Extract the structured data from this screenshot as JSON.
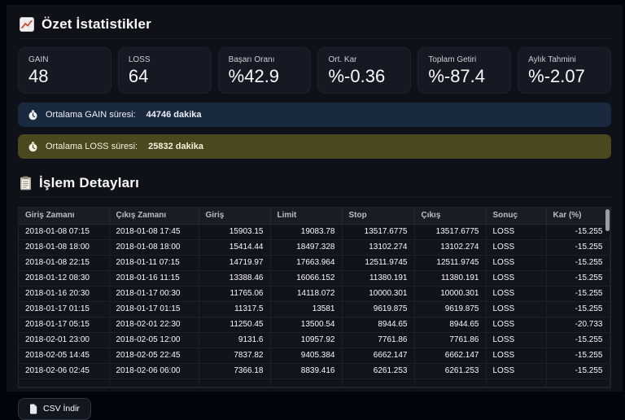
{
  "summary": {
    "title": "Özet İstatistikler",
    "cards": [
      {
        "label": "GAIN",
        "value": "48"
      },
      {
        "label": "LOSS",
        "value": "64"
      },
      {
        "label": "Başarı Oranı",
        "value": "%42.9"
      },
      {
        "label": "Ort. Kar",
        "value": "%-0.36"
      },
      {
        "label": "Toplam Getiri",
        "value": "%-87.4"
      },
      {
        "label": "Aylık Tahmini",
        "value": "%-2.07"
      }
    ],
    "gain_info": {
      "label": "Ortalama GAIN süresi:",
      "value": "44746 dakika"
    },
    "loss_info": {
      "label": "Ortalama LOSS süresi:",
      "value": "25832 dakika"
    }
  },
  "details": {
    "title": "İşlem Detayları",
    "columns": [
      "Giriş Zamanı",
      "Çıkış Zamanı",
      "Giriş",
      "Limit",
      "Stop",
      "Çıkış",
      "Sonuç",
      "Kar (%)"
    ],
    "rows": [
      [
        "2018-01-08 07:15",
        "2018-01-08 17:45",
        "15903.15",
        "19083.78",
        "13517.6775",
        "13517.6775",
        "LOSS",
        "-15.255"
      ],
      [
        "2018-01-08 18:00",
        "2018-01-08 18:00",
        "15414.44",
        "18497.328",
        "13102.274",
        "13102.274",
        "LOSS",
        "-15.255"
      ],
      [
        "2018-01-08 22:15",
        "2018-01-11 07:15",
        "14719.97",
        "17663.964",
        "12511.9745",
        "12511.9745",
        "LOSS",
        "-15.255"
      ],
      [
        "2018-01-12 08:30",
        "2018-01-16 11:15",
        "13388.46",
        "16066.152",
        "11380.191",
        "11380.191",
        "LOSS",
        "-15.255"
      ],
      [
        "2018-01-16 20:30",
        "2018-01-17 00:30",
        "11765.06",
        "14118.072",
        "10000.301",
        "10000.301",
        "LOSS",
        "-15.255"
      ],
      [
        "2018-01-17 01:15",
        "2018-01-17 01:15",
        "11317.5",
        "13581",
        "9619.875",
        "9619.875",
        "LOSS",
        "-15.255"
      ],
      [
        "2018-01-17 05:15",
        "2018-02-01 22:30",
        "11250.45",
        "13500.54",
        "8944.65",
        "8944.65",
        "LOSS",
        "-20.733"
      ],
      [
        "2018-02-01 23:00",
        "2018-02-05 12:00",
        "9131.6",
        "10957.92",
        "7761.86",
        "7761.86",
        "LOSS",
        "-15.255"
      ],
      [
        "2018-02-05 14:45",
        "2018-02-05 22:45",
        "7837.82",
        "9405.384",
        "6662.147",
        "6662.147",
        "LOSS",
        "-15.255"
      ],
      [
        "2018-02-06 02:45",
        "2018-02-06 06:00",
        "7366.18",
        "8839.416",
        "6261.253",
        "6261.253",
        "LOSS",
        "-15.255"
      ]
    ],
    "download_label": "CSV İndir"
  },
  "icons": {
    "summary_title": "chart-icon",
    "details_title": "clipboard-icon",
    "info_bars": "stopwatch-icon",
    "csv_button": "file-icon"
  },
  "colors": {
    "app_background": "#0e1117",
    "card_background": "#151923",
    "info_gain_background": "#1a2a3e",
    "info_loss_background": "#4b471f",
    "chart_icon_line": "#d8402f",
    "text_primary": "#fafafa"
  }
}
